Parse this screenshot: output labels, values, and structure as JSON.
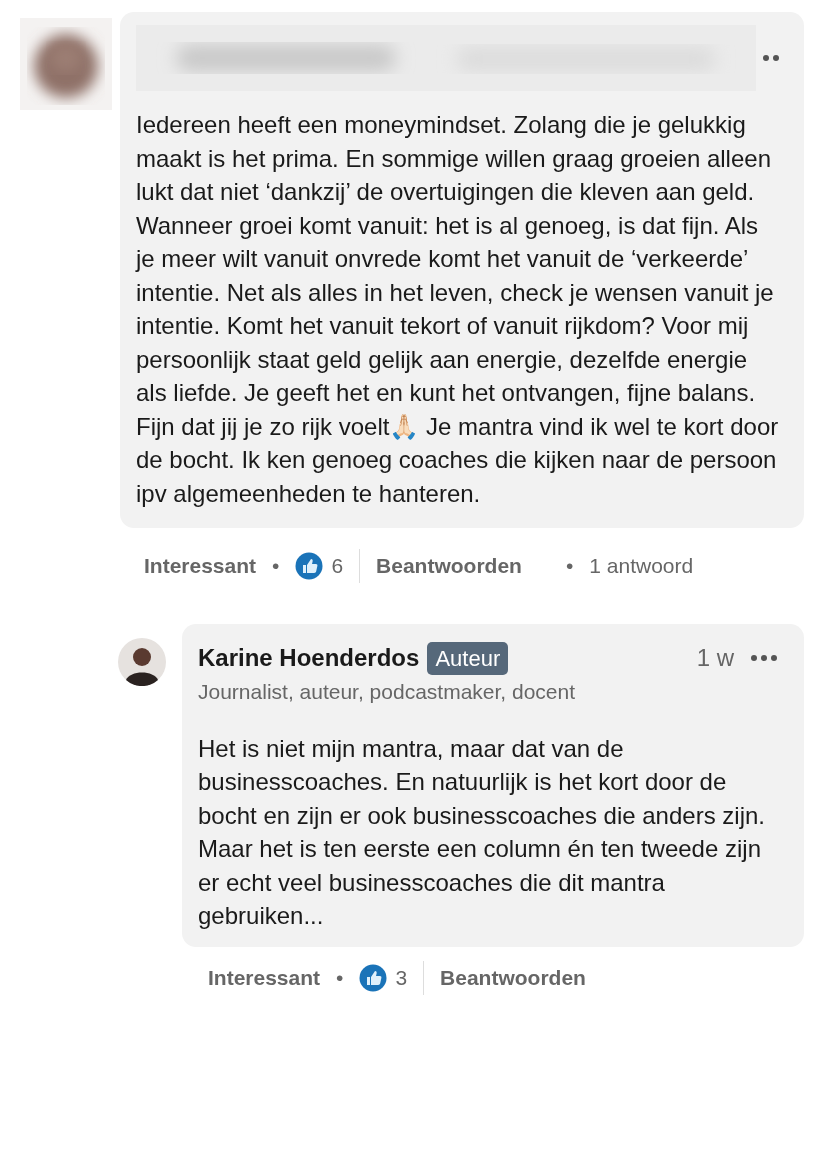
{
  "comment": {
    "paragraphs": [
      "Iedereen heeft een moneymindset. Zolang die je gelukkig maakt is het prima. En sommige willen graag groeien alleen lukt dat niet ‘dankzij’ de overtuigingen die kleven aan geld. Wanneer groei komt vanuit: het is al genoeg, is dat fijn. Als je meer wilt vanuit onvrede komt het vanuit de ‘verkeerde’ intentie. Net als alles in het leven, check je wensen vanuit je intentie. Komt het vanuit tekort of vanuit rijkdom? Voor mij persoonlijk staat geld gelijk aan energie, dezelfde energie als liefde. Je geeft het en kunt het ontvangen, fijne balans.",
      "Fijn dat jij je zo rijk voelt🙏🏻 Je mantra vind ik wel te kort door de bocht. Ik ken genoeg coaches die kijken naar de persoon ipv algemeenheden te hanteren."
    ],
    "actions": {
      "like": "Interessant",
      "dot": "•",
      "count": "6",
      "reply": "Beantwoorden",
      "replies_dot": "•",
      "replies": "1 antwoord"
    }
  },
  "reply": {
    "author": "Karine Hoenderdos",
    "badge": "Auteur",
    "time": "1 w",
    "headline": "Journalist, auteur, podcastmaker, docent",
    "paragraphs": [
      "Het is niet mijn mantra, maar dat van de businesscoaches. En natuurlijk is het kort door de bocht en zijn er ook businesscoaches die anders zijn. Maar het is ten eerste een column én ten tweede zijn er echt veel businesscoaches die dit mantra gebruiken..."
    ],
    "actions": {
      "like": "Interessant",
      "dot": "•",
      "count": "3",
      "reply": "Beantwoorden"
    }
  }
}
